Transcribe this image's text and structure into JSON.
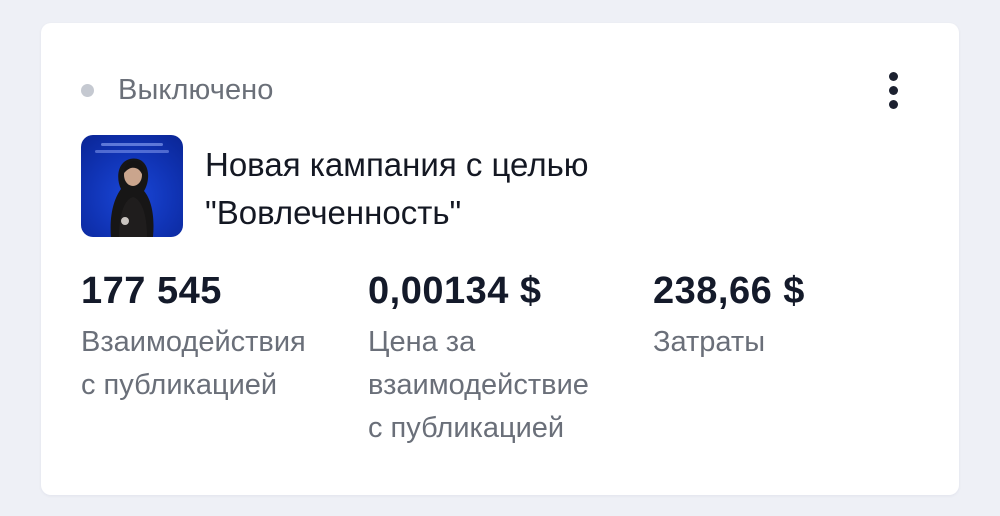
{
  "status": {
    "label": "Выключено",
    "dot_color": "#c5c9d1"
  },
  "menu": {
    "icon": "more-vertical-icon"
  },
  "campaign": {
    "title": "Новая кампания с целью \"Вовлеченность\"",
    "thumbnail_bg": "#1033b4"
  },
  "metrics": [
    {
      "value": "177 545",
      "label": "Взаимодействия\nс публикацией"
    },
    {
      "value": "0,00134 $",
      "label": "Цена за\nвзаимодействие\nс публикацией"
    },
    {
      "value": "238,66 $",
      "label": "Затраты"
    }
  ]
}
